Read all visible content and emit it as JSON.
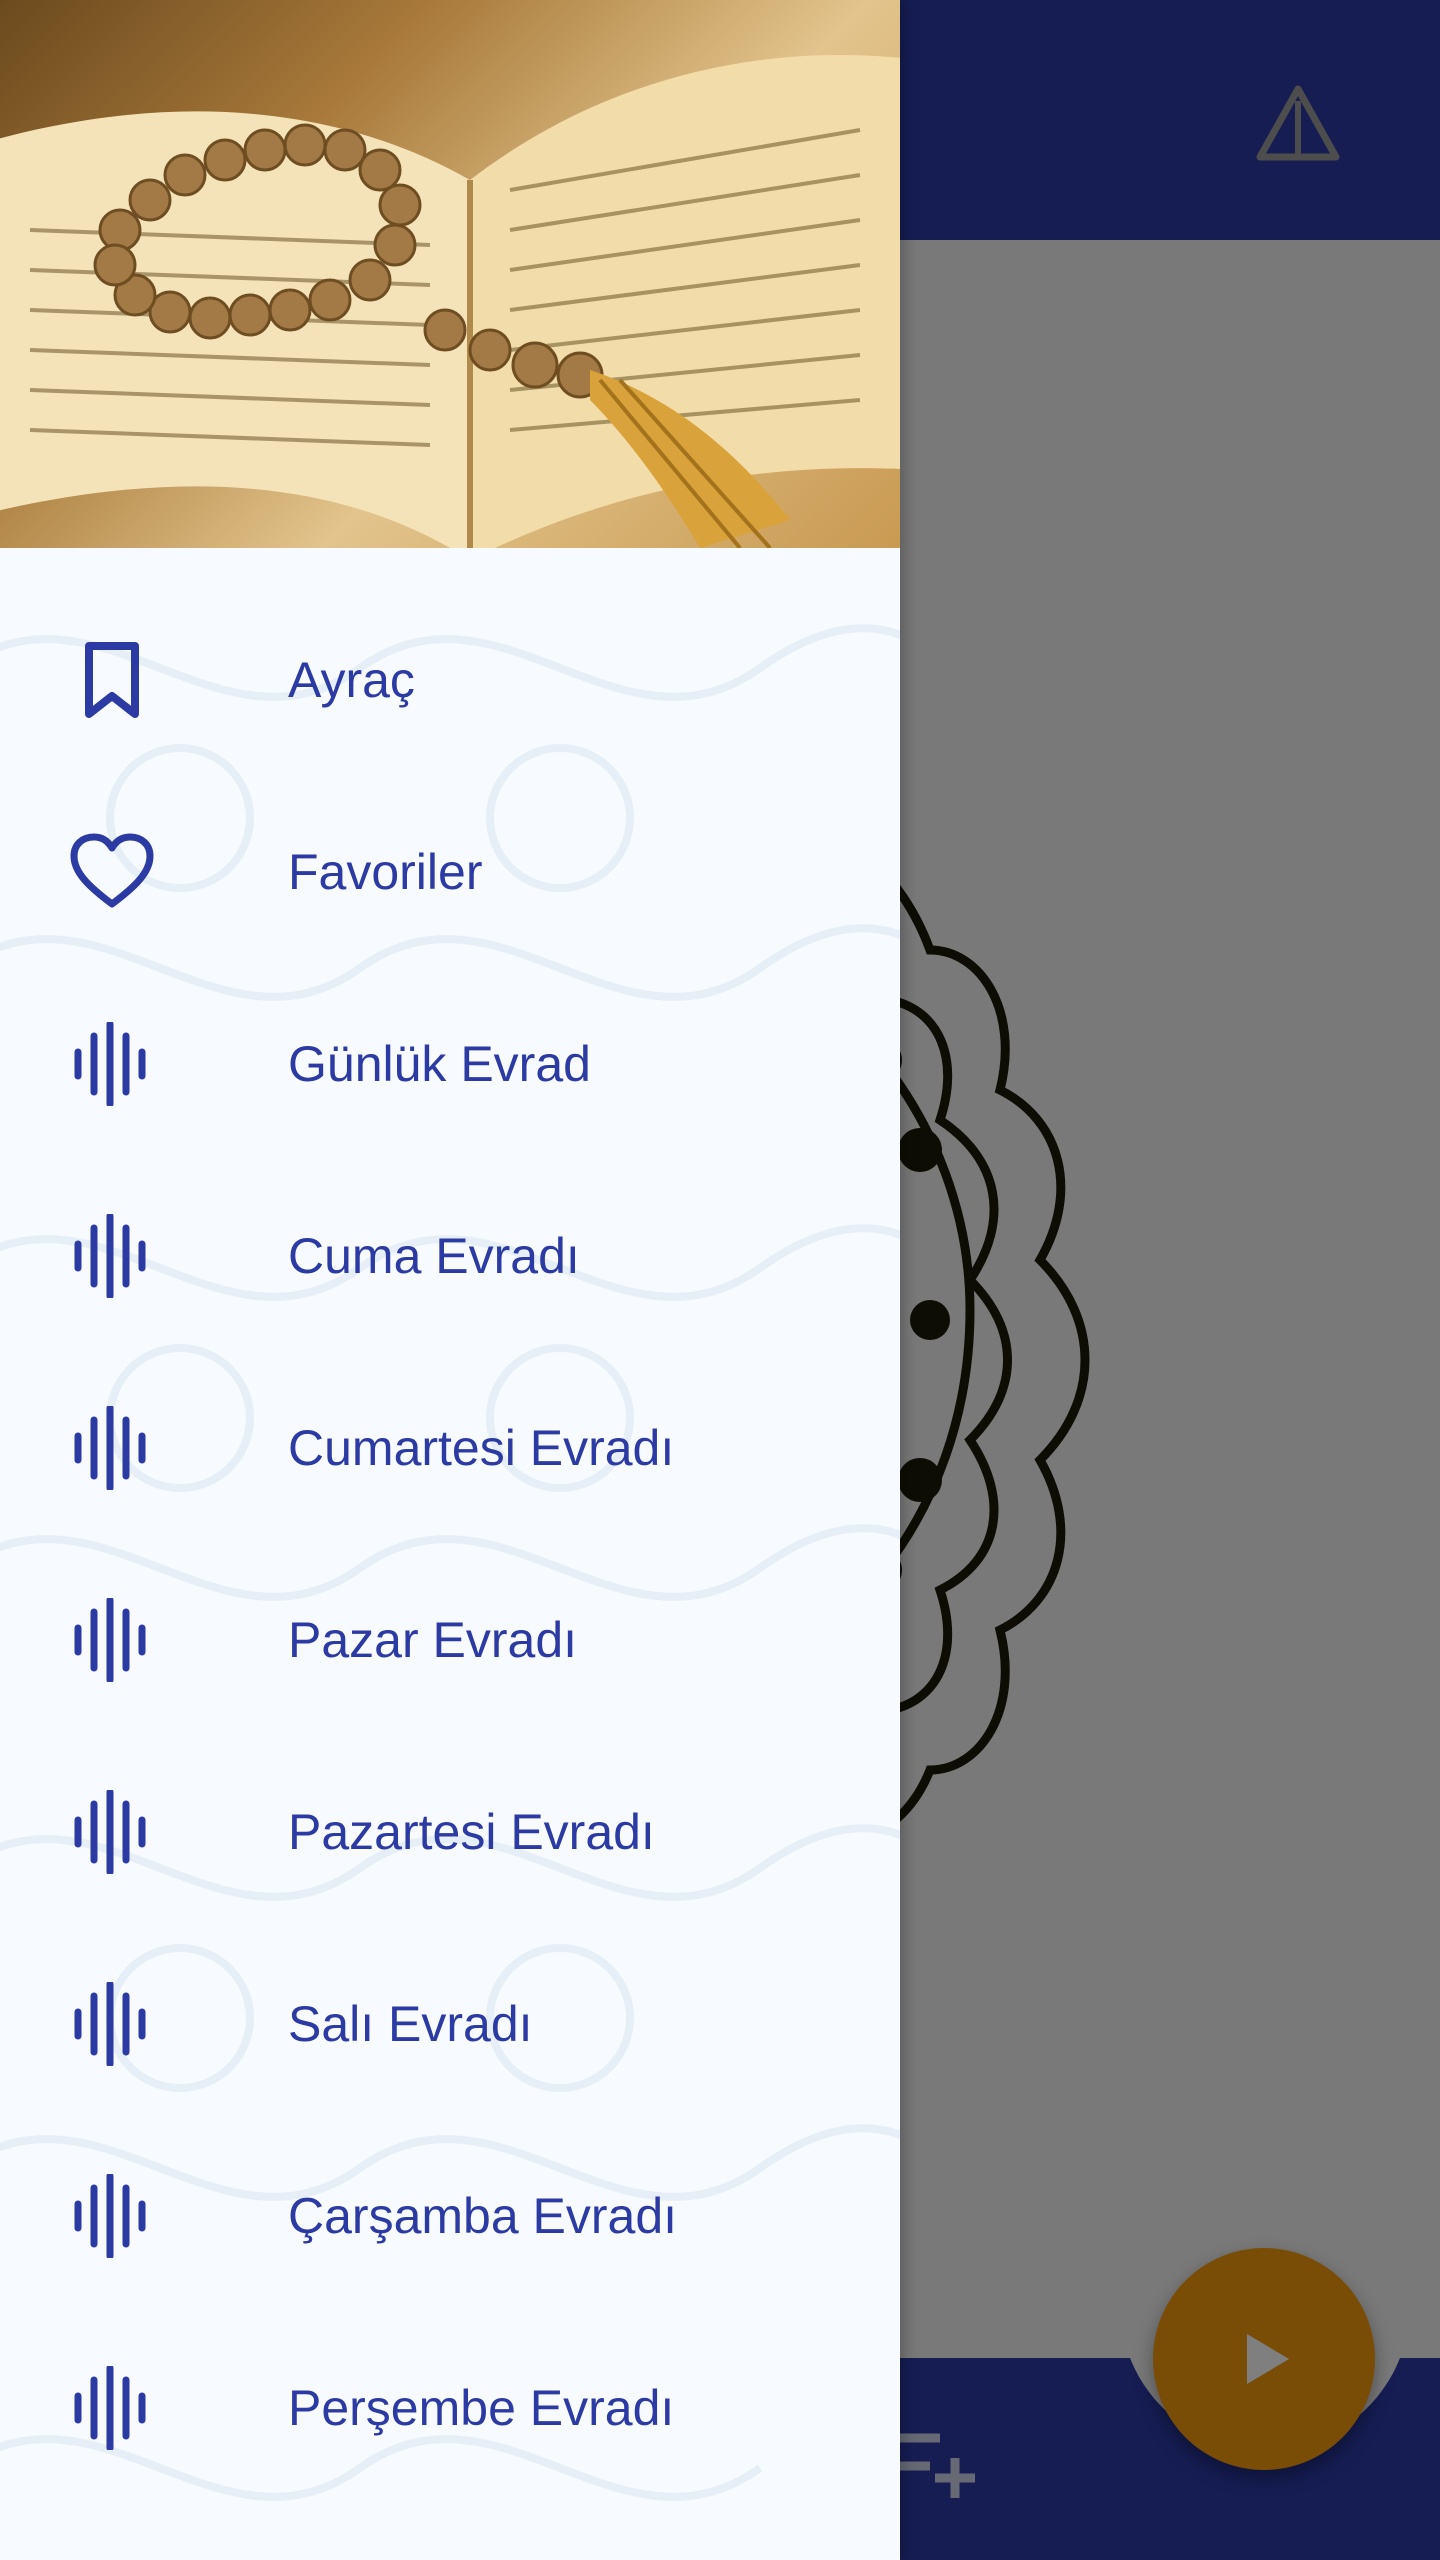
{
  "background_app": {
    "toolbar_action_icon": "warning-triangle-icon",
    "add_text_icon": "text-add-icon",
    "play_icon": "play-icon",
    "colors": {
      "primary": "#2a3aa6",
      "accent": "#f29a0c"
    }
  },
  "drawer": {
    "header_image": "quran-with-prayer-beads",
    "menu": [
      {
        "label": "Ayraç",
        "icon": "bookmark-icon"
      },
      {
        "label": "Favoriler",
        "icon": "heart-icon"
      },
      {
        "label": "Günlük Evrad",
        "icon": "audio-wave-icon"
      },
      {
        "label": "Cuma Evradı",
        "icon": "audio-wave-icon"
      },
      {
        "label": "Cumartesi Evradı",
        "icon": "audio-wave-icon"
      },
      {
        "label": "Pazar Evradı",
        "icon": "audio-wave-icon"
      },
      {
        "label": "Pazartesi Evradı",
        "icon": "audio-wave-icon"
      },
      {
        "label": "Salı Evradı",
        "icon": "audio-wave-icon"
      },
      {
        "label": "Çarşamba Evradı",
        "icon": "audio-wave-icon"
      },
      {
        "label": "Perşembe Evradı",
        "icon": "audio-wave-icon"
      }
    ],
    "colors": {
      "item_text": "#2c3aa3",
      "background": "#f7fbff"
    }
  }
}
